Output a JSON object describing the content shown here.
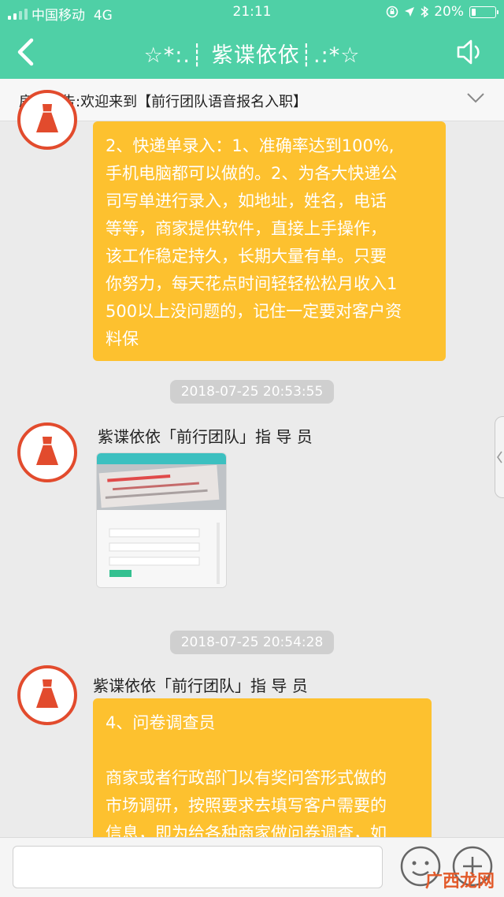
{
  "status_bar": {
    "carrier": "中国移动",
    "network": "4G",
    "time": "21:11",
    "battery_percent": "20%",
    "battery_level": 0.2
  },
  "header": {
    "title": "☆*:.┊ 紫谍依依┊.:*☆"
  },
  "announcement": {
    "text": "房间公告:欢迎来到【前行团队语音报名入职】"
  },
  "messages": [
    {
      "type": "text",
      "lines": [
        "2、快递单录入：1、准确率达到100%,",
        "手机电脑都可以做的。2、为各大快递公",
        "司写单进行录入，如地址，姓名，电话",
        "等等，商家提供软件，直接上手操作，",
        "该工作稳定持久，长期大量有单。只要",
        "你努力，每天花点时间轻轻松松月收入1",
        "500以上没问题的，记住一定要对客户资",
        "料保"
      ]
    },
    {
      "type": "timestamp",
      "text": "2018-07-25 20:53:55"
    },
    {
      "type": "image",
      "sender": "紫谍依依「前行团队」指 导 员"
    },
    {
      "type": "timestamp",
      "text": "2018-07-25 20:54:28"
    },
    {
      "type": "text",
      "sender": "紫谍依依「前行团队」指 导 员",
      "lines": [
        "4、问卷调查员",
        "",
        "商家或者行政部门以有奖问答形式做的",
        "市场调研，按照要求去填写客户需要的",
        "信息，即为给各种商家做问卷调查，如"
      ]
    }
  ],
  "watermark": "广西龙网",
  "colors": {
    "header": "#4fd0a6",
    "bubble": "#fdc12f",
    "avatar_red": "#e24b2d"
  }
}
